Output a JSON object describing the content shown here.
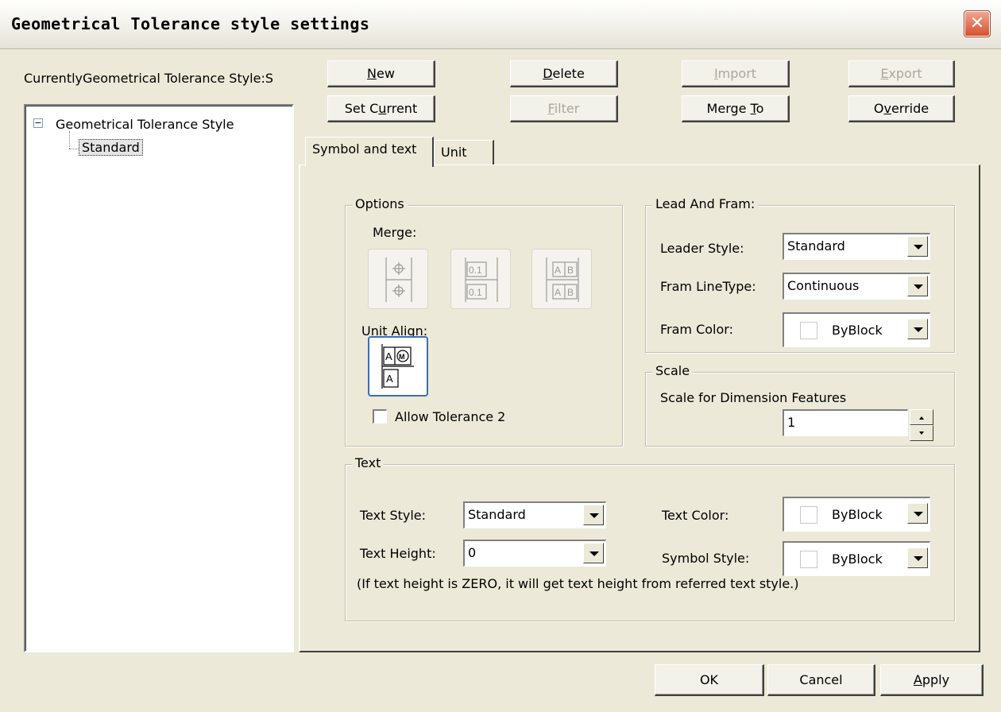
{
  "window": {
    "title": "Geometrical Tolerance style settings",
    "close_glyph": "✕"
  },
  "current_style_label": "CurrentlyGeometrical Tolerance Style:S",
  "tree": {
    "expander": "−",
    "root": "Geometrical Tolerance Style",
    "child": "Standard"
  },
  "toolbar": {
    "new_pre": "",
    "new_key": "N",
    "new_post": "ew",
    "delete_pre": "",
    "delete_key": "D",
    "delete_post": "elete",
    "import_pre": "",
    "import_key": "I",
    "import_post": "mport",
    "export_pre": "",
    "export_key": "E",
    "export_post": "xport",
    "setcurrent_pre": "Set C",
    "setcurrent_key": "u",
    "setcurrent_post": "rrent",
    "filter_pre": "",
    "filter_key": "F",
    "filter_post": "ilter",
    "mergeto_pre": "Merge ",
    "mergeto_key": "T",
    "mergeto_post": "o",
    "override_pre": "O",
    "override_key": "v",
    "override_post": "erride"
  },
  "tabs": {
    "symbol_text": "Symbol and text",
    "unit": "Unit"
  },
  "options": {
    "legend": "Options",
    "merge_label": "Merge:",
    "icon1_a": "⌖",
    "icon1_b": "⌖",
    "icon2_a": "0.1",
    "icon2_b": "0.1",
    "icon3_a1": "A",
    "icon3_a2": "B",
    "icon3_b1": "A",
    "icon3_b2": "B",
    "unit_align_label": "Unit Align:",
    "align_a1": "A",
    "align_m": "M",
    "align_a2": "A",
    "allow_tol2": "Allow Tolerance 2",
    "allow_tol2_checked": false
  },
  "lead": {
    "legend": "Lead And Fram:",
    "leader_style_label": "Leader Style:",
    "leader_style_value": "Standard",
    "fram_linetype_label": "Fram LineType:",
    "fram_linetype_value": "Continuous",
    "fram_color_label": "Fram Color:",
    "fram_color_value": "ByBlock"
  },
  "scale": {
    "legend": "Scale",
    "label": "Scale for Dimension Features",
    "value": "1"
  },
  "text": {
    "legend": "Text",
    "text_style_label": "Text Style:",
    "text_style_value": "Standard",
    "text_height_label": "Text Height:",
    "text_height_value": "0",
    "text_color_label": "Text Color:",
    "text_color_value": "ByBlock",
    "symbol_style_label": "Symbol Style:",
    "symbol_style_value": "ByBlock",
    "note": "(If text height is ZERO, it will get text height from referred text style.)"
  },
  "footer": {
    "ok": "OK",
    "cancel": "Cancel",
    "apply_key": "A",
    "apply_post": "pply"
  }
}
